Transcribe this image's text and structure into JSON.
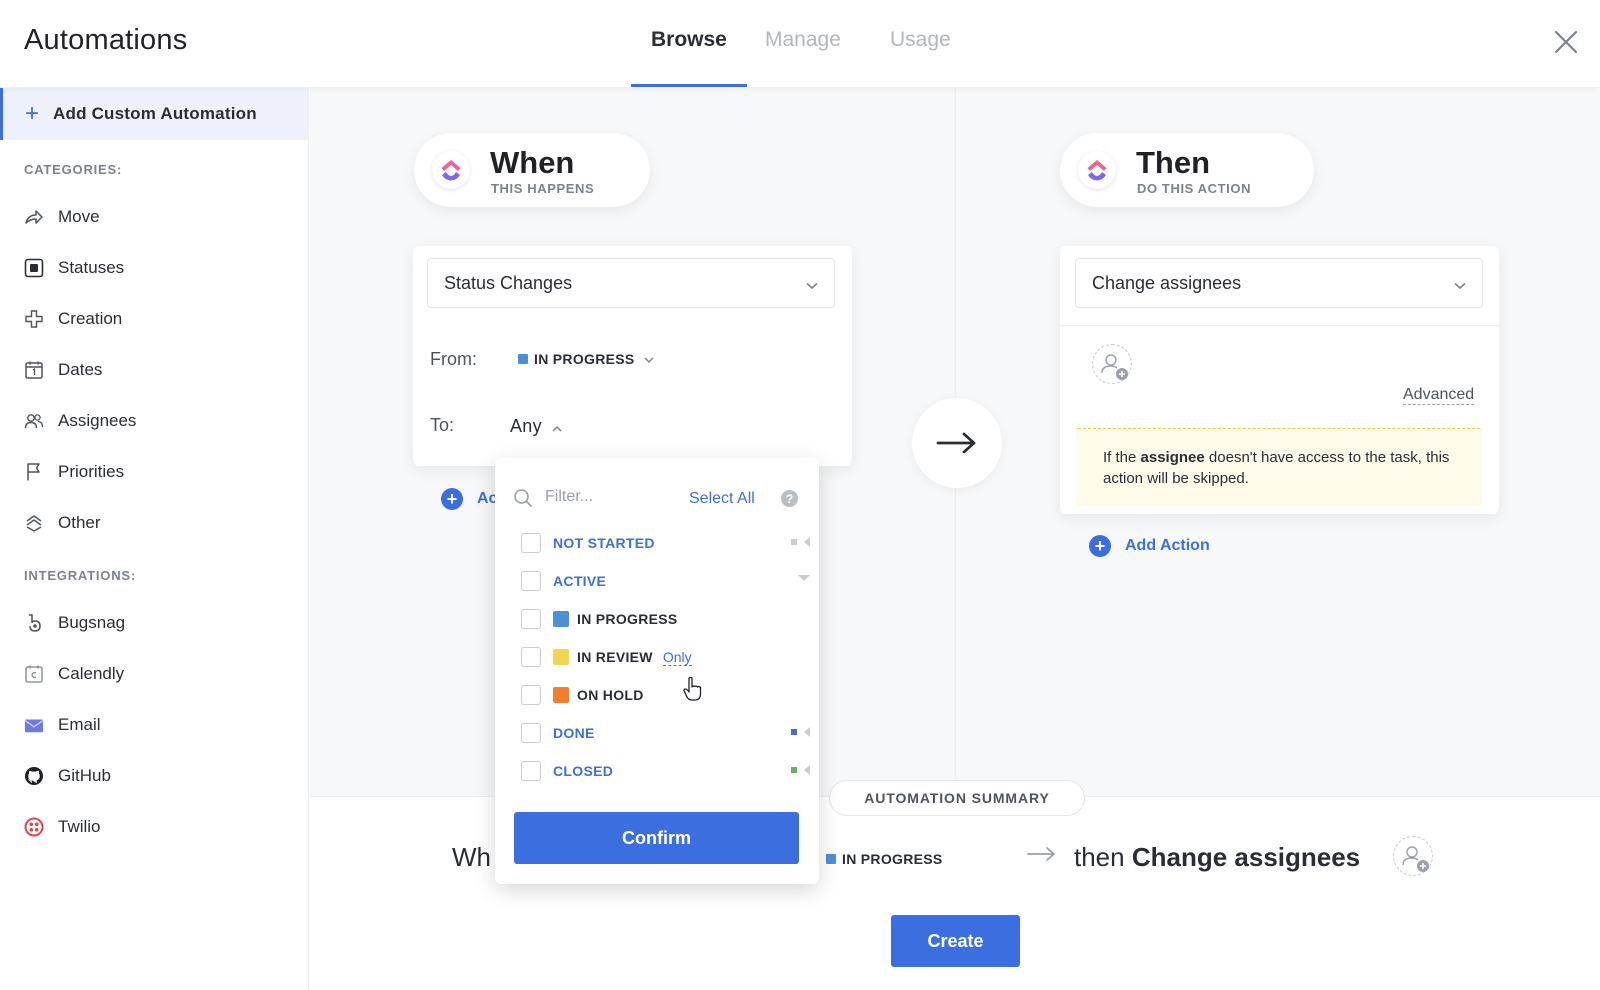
{
  "header": {
    "title": "Automations",
    "tabs": [
      {
        "label": "Browse",
        "active": true
      },
      {
        "label": "Manage",
        "active": false
      },
      {
        "label": "Usage",
        "active": false
      }
    ]
  },
  "sidebar": {
    "add_custom": "Add Custom Automation",
    "categories_label": "CATEGORIES:",
    "categories": [
      {
        "label": "Move",
        "icon": "move-arrow-icon"
      },
      {
        "label": "Statuses",
        "icon": "status-square-icon"
      },
      {
        "label": "Creation",
        "icon": "creation-plus-icon"
      },
      {
        "label": "Dates",
        "icon": "calendar-icon"
      },
      {
        "label": "Assignees",
        "icon": "people-icon"
      },
      {
        "label": "Priorities",
        "icon": "flag-icon"
      },
      {
        "label": "Other",
        "icon": "stack-icon"
      }
    ],
    "integrations_label": "INTEGRATIONS:",
    "integrations": [
      {
        "label": "Bugsnag",
        "icon": "bugsnag-icon"
      },
      {
        "label": "Calendly",
        "icon": "calendly-icon"
      },
      {
        "label": "Email",
        "icon": "email-icon"
      },
      {
        "label": "GitHub",
        "icon": "github-icon"
      },
      {
        "label": "Twilio",
        "icon": "twilio-icon"
      }
    ]
  },
  "when": {
    "title": "When",
    "subtitle": "THIS HAPPENS",
    "trigger": "Status Changes",
    "from_label": "From:",
    "from_value": "IN PROGRESS",
    "to_label": "To:",
    "to_value": "Any",
    "add_partial": "Ac"
  },
  "then": {
    "title": "Then",
    "subtitle": "DO THIS ACTION",
    "action": "Change assignees",
    "advanced": "Advanced",
    "notice_pre": "If the ",
    "notice_bold": "assignee",
    "notice_post": " doesn't have access to the task, this action will be skipped.",
    "add_action": "Add Action"
  },
  "dropdown": {
    "filter_placeholder": "Filter...",
    "select_all": "Select All",
    "help": "?",
    "options": [
      {
        "label": "NOT STARTED",
        "kind": "group"
      },
      {
        "label": "ACTIVE",
        "kind": "group"
      },
      {
        "label": "IN PROGRESS",
        "kind": "status",
        "color": "#4a90d9"
      },
      {
        "label": "IN REVIEW",
        "kind": "status",
        "color": "#f5d451",
        "only": "Only"
      },
      {
        "label": "ON HOLD",
        "kind": "status",
        "color": "#f07f2d"
      },
      {
        "label": "DONE",
        "kind": "group"
      },
      {
        "label": "CLOSED",
        "kind": "group"
      }
    ],
    "confirm": "Confirm"
  },
  "summary": {
    "badge": "AUTOMATION SUMMARY",
    "when_partial": "Wh",
    "status": "IN PROGRESS",
    "then_prefix": "then ",
    "then_action": "Change assignees"
  },
  "create": "Create",
  "colors": {
    "accent": "#3b6fe0",
    "in_progress": "#4a90d9",
    "in_review": "#f5d451",
    "on_hold": "#f07f2d",
    "notice_bg": "#fffbea"
  }
}
